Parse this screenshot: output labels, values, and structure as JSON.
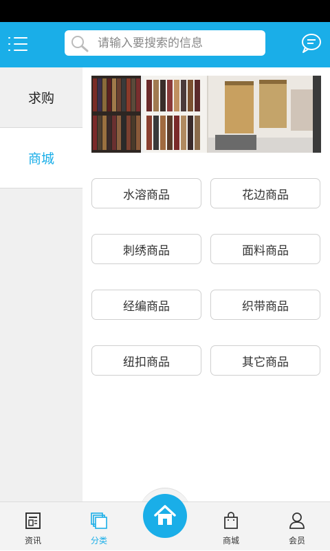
{
  "header": {
    "search_placeholder": "请输入要搜索的信息"
  },
  "sidebar": {
    "items": [
      {
        "label": "求购"
      },
      {
        "label": "商城"
      }
    ]
  },
  "categories": [
    {
      "label": "水溶商品"
    },
    {
      "label": "花边商品"
    },
    {
      "label": "刺绣商品"
    },
    {
      "label": "面料商品"
    },
    {
      "label": "经编商品"
    },
    {
      "label": "织带商品"
    },
    {
      "label": "纽扣商品"
    },
    {
      "label": "其它商品"
    }
  ],
  "bottom_nav": {
    "items": [
      {
        "label": "资讯",
        "icon": "news-icon"
      },
      {
        "label": "分类",
        "icon": "category-icon",
        "active": true
      },
      {
        "label": "",
        "icon": "home-icon"
      },
      {
        "label": "商城",
        "icon": "shopping-bag-icon"
      },
      {
        "label": "会员",
        "icon": "user-icon"
      }
    ]
  },
  "colors": {
    "accent": "#1aaee8",
    "status_bar": "#000000",
    "sidebar_bg": "#f0f0f0"
  }
}
